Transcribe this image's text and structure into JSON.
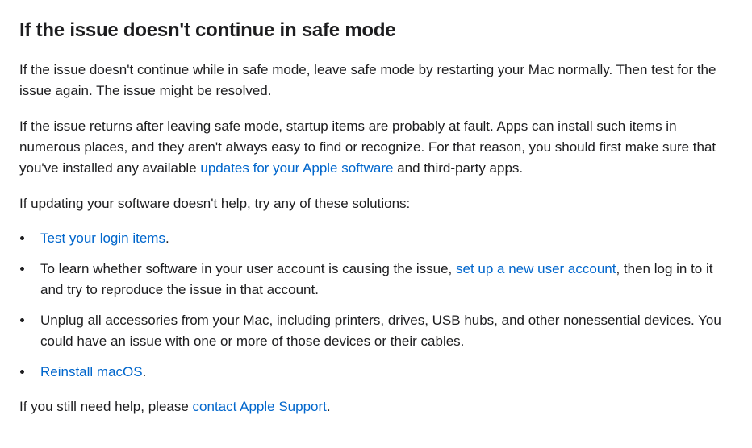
{
  "heading": "If the issue doesn't continue in safe mode",
  "para1": "If the issue doesn't continue while in safe mode, leave safe mode by restarting your Mac normally. Then test for the issue again. The issue might be resolved.",
  "para2_prefix": "If the issue returns after leaving safe mode, startup items are probably at fault. Apps can install such items in numerous places, and they aren't always easy to find or recognize. For that reason, you should first make sure that you've installed any available ",
  "para2_link": "updates for your Apple software",
  "para2_suffix": " and third-party apps.",
  "para3": "If updating your software doesn't help, try any of these solutions:",
  "list": {
    "item1_link": "Test your login items",
    "item1_suffix": ".",
    "item2_prefix": "To learn whether software in your user account is causing the issue, ",
    "item2_link": "set up a new user account",
    "item2_suffix": ", then log in to it and try to reproduce the issue in that account.",
    "item3": "Unplug all accessories from your Mac, including printers, drives, USB hubs, and other nonessential devices. You could have an issue with one or more of those devices or their cables.",
    "item4_link": "Reinstall macOS",
    "item4_suffix": "."
  },
  "para4_prefix": "If you still need help, please ",
  "para4_link": "contact Apple Support",
  "para4_suffix": "."
}
